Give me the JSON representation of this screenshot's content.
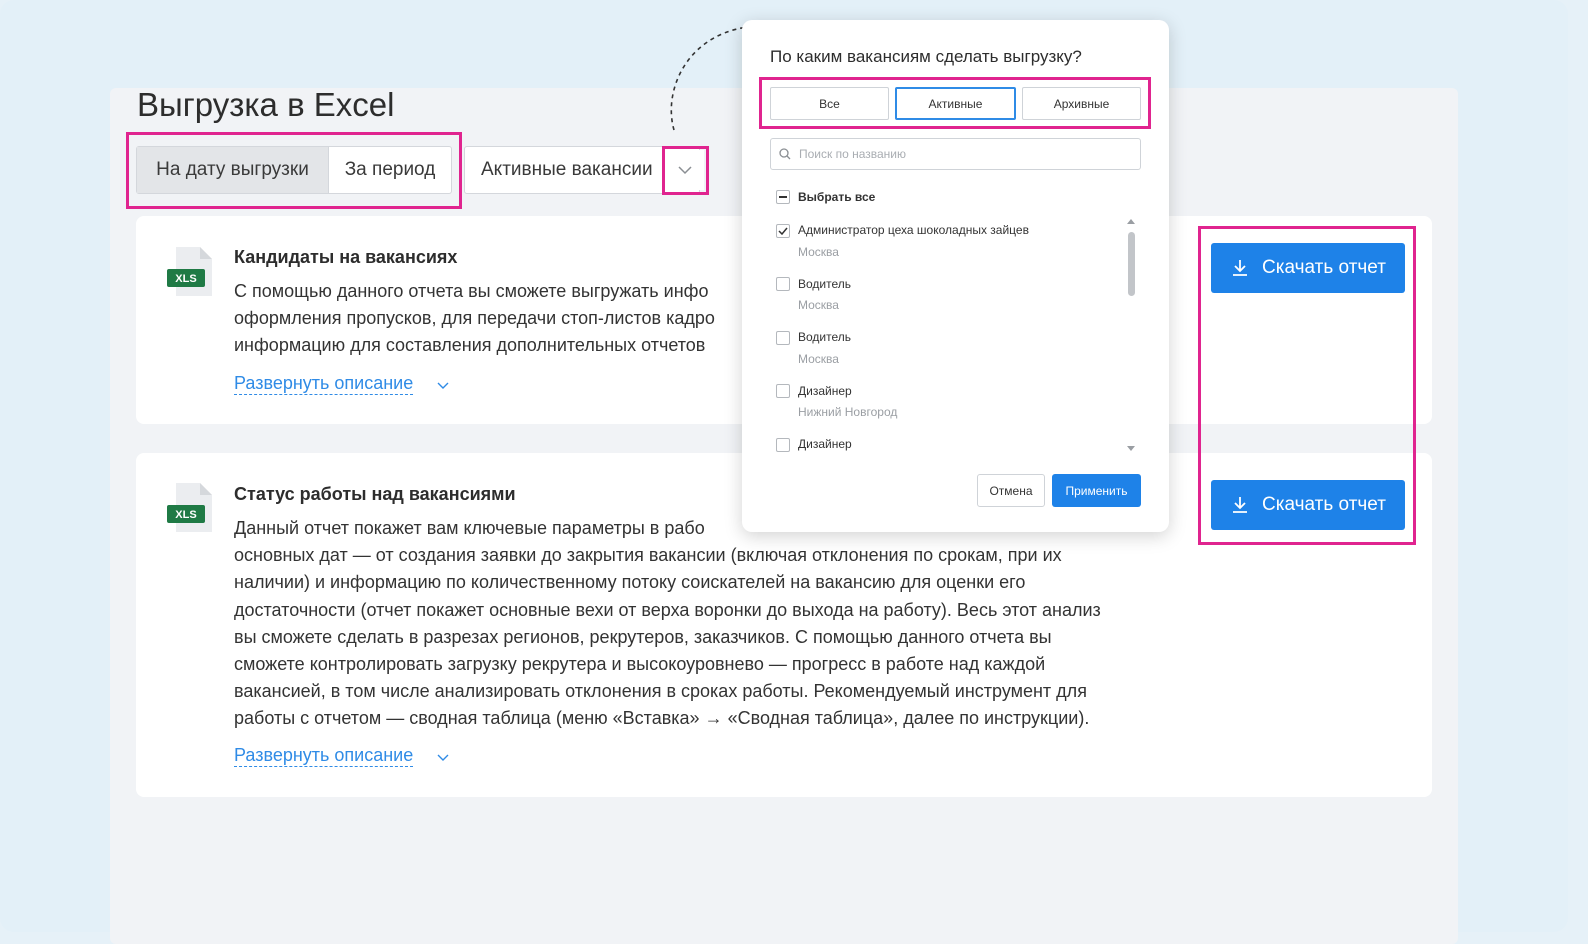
{
  "page": {
    "title": "Выгрузка в Excel"
  },
  "mode_tabs": [
    {
      "label": "На дату выгрузки",
      "active": true
    },
    {
      "label": "За период",
      "active": false
    }
  ],
  "vacancy_filter": {
    "value": "Активные вакансии"
  },
  "reports": [
    {
      "icon_label": "XLS",
      "title": "Кандидаты на вакансиях",
      "desc_lines": [
        "С помощью данного отчета вы сможете выгружать инфо",
        "оформления пропусков, для передачи стоп-листов кадро",
        "информацию для составления дополнительных отчетов"
      ],
      "expand_label": "Развернуть описание",
      "download_label": "Скачать отчет"
    },
    {
      "icon_label": "XLS",
      "title": "Статус работы над вакансиями",
      "desc_lines": [
        "Данный отчет покажет вам ключевые параметры в рабо",
        "основных дат — от создания заявки до закрытия вакансии (включая отклонения по срокам, при их",
        "наличии) и информацию по количественному потоку соискателей на вакансию для оценки его",
        "достаточности (отчет покажет основные вехи от верха воронки до выхода на работу). Весь этот анализ",
        "вы сможете сделать в разрезах регионов, рекрутеров, заказчиков. С помощью данного отчета вы",
        "сможете контролировать загрузку рекрутера и высокоуровнево — прогресс в работе над каждой",
        "вакансией, в том числе анализировать отклонения в сроках работы. Рекомендуемый инструмент для",
        "работы с отчетом — сводная таблица (меню «Вставка» → «Сводная таблица», далее по инструкции)."
      ],
      "expand_label": "Развернуть описание",
      "download_label": "Скачать отчет"
    }
  ],
  "popup": {
    "title": "По каким вакансиям сделать выгрузку?",
    "tabs": [
      {
        "label": "Все",
        "active": false
      },
      {
        "label": "Активные",
        "active": true
      },
      {
        "label": "Архивные",
        "active": false
      }
    ],
    "search_placeholder": "Поиск по названию",
    "select_all_label": "Выбрать все",
    "items": [
      {
        "name": "Администратор цеха шоколадных зайцев",
        "city": "Москва",
        "checked": true
      },
      {
        "name": "Водитель",
        "city": "Москва",
        "checked": false
      },
      {
        "name": "Водитель",
        "city": "Москва",
        "checked": false
      },
      {
        "name": "Дизайнер",
        "city": "Нижний Новгород",
        "checked": false
      },
      {
        "name": "Дизайнер",
        "city": "",
        "checked": false
      }
    ],
    "cancel_label": "Отмена",
    "apply_label": "Применить"
  },
  "colors": {
    "accent": "#1e82e8",
    "highlight": "#e0248f",
    "link": "#2f8be6",
    "xls_green": "#1f7a45"
  }
}
